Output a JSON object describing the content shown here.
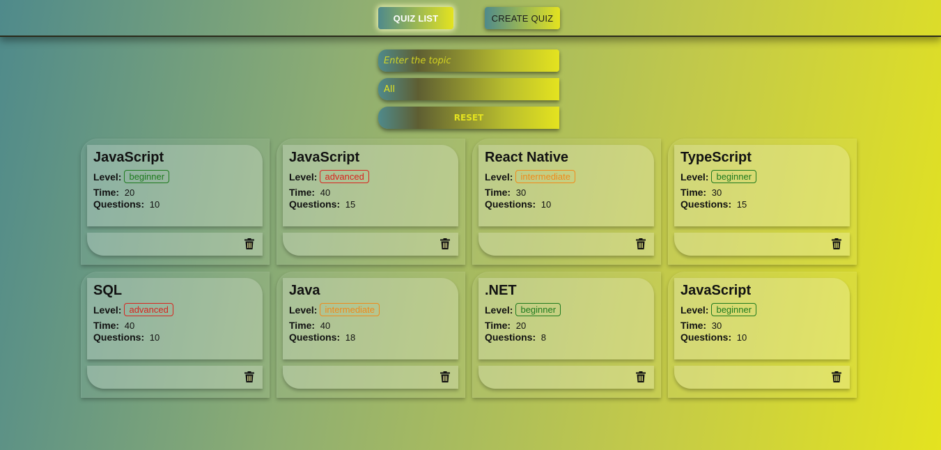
{
  "nav": {
    "quiz_list": "QUIZ LIST",
    "create_quiz": "CREATE QUIZ"
  },
  "filters": {
    "topic_placeholder": "Enter the topic",
    "level_value": "All",
    "reset_label": "RESET"
  },
  "labels": {
    "level": "Level:",
    "time": "Time:",
    "questions": "Questions:"
  },
  "quizzes": [
    {
      "title": "JavaScript",
      "level": "beginner",
      "time": "20",
      "questions": "10"
    },
    {
      "title": "JavaScript",
      "level": "advanced",
      "time": "40",
      "questions": "15"
    },
    {
      "title": "React Native",
      "level": "intermediate",
      "time": "30",
      "questions": "10"
    },
    {
      "title": "TypeScript",
      "level": "beginner",
      "time": "30",
      "questions": "15"
    },
    {
      "title": "SQL",
      "level": "advanced",
      "time": "40",
      "questions": "10"
    },
    {
      "title": "Java",
      "level": "intermediate",
      "time": "40",
      "questions": "18"
    },
    {
      "title": ".NET",
      "level": "beginner",
      "time": "20",
      "questions": "8"
    },
    {
      "title": "JavaScript",
      "level": "beginner",
      "time": "30",
      "questions": "10"
    }
  ],
  "icons": {
    "delete": "trash-icon"
  },
  "colors": {
    "beginner": "#1e7a1e",
    "advanced": "#d8241e",
    "intermediate": "#f08a1a",
    "accent": "#e4e31f"
  }
}
